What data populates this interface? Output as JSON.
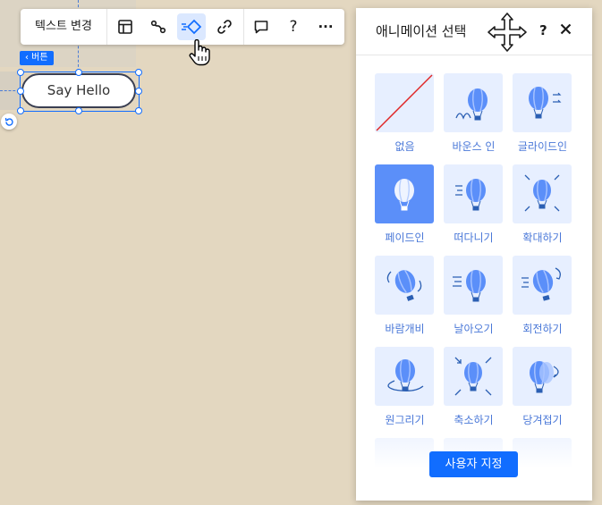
{
  "toolbar": {
    "change_text_label": "텍스트 변경",
    "buttons": [
      {
        "icon": "layout-icon",
        "active": false
      },
      {
        "icon": "connect-icon",
        "active": false
      },
      {
        "icon": "animation-icon",
        "active": true
      },
      {
        "icon": "link-icon",
        "active": false
      },
      {
        "icon": "comment-icon",
        "active": false
      },
      {
        "icon": "help-icon",
        "label": "?",
        "active": false
      },
      {
        "icon": "more-icon",
        "label": "···",
        "active": false
      }
    ]
  },
  "element": {
    "type_label": "‹ 버튼",
    "button_text": "Say Hello"
  },
  "panel": {
    "title": "애니메이션 선택",
    "help_label": "?",
    "custom_button": "사용자 지정",
    "animations": [
      {
        "label": "없음",
        "selected": false
      },
      {
        "label": "바운스 인",
        "selected": false
      },
      {
        "label": "글라이드인",
        "selected": false
      },
      {
        "label": "페이드인",
        "selected": true
      },
      {
        "label": "떠다니기",
        "selected": false
      },
      {
        "label": "확대하기",
        "selected": false
      },
      {
        "label": "바람개비",
        "selected": false
      },
      {
        "label": "날아오기",
        "selected": false
      },
      {
        "label": "회전하기",
        "selected": false
      },
      {
        "label": "원그리기",
        "selected": false
      },
      {
        "label": "축소하기",
        "selected": false
      },
      {
        "label": "당겨접기",
        "selected": false
      }
    ]
  },
  "colors": {
    "accent": "#116dff",
    "thumb_bg": "#e7efff",
    "thumb_selected": "#5b8ff9",
    "label_blue": "#4a78d8",
    "canvas_bg": "#e3d7c0"
  }
}
